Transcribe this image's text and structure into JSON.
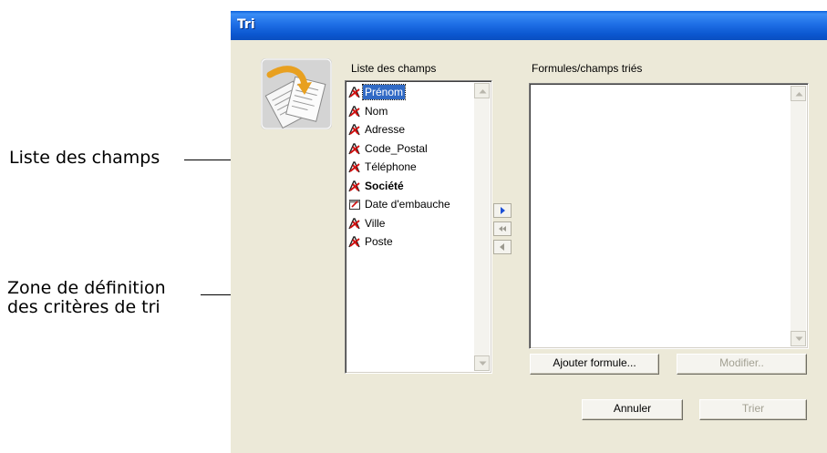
{
  "callouts": {
    "field_list": "Liste des champs",
    "criteria_line1": "Zone de définition",
    "criteria_line2": "des critères de tri"
  },
  "window": {
    "title": "Tri",
    "icon": "sort-documents-icon"
  },
  "fields_panel": {
    "label": "Liste des champs",
    "items": [
      {
        "label": "Prénom",
        "icon": "text-field-icon",
        "selected": true
      },
      {
        "label": "Nom",
        "icon": "text-field-icon"
      },
      {
        "label": "Adresse",
        "icon": "text-field-icon"
      },
      {
        "label": "Code_Postal",
        "icon": "text-field-icon"
      },
      {
        "label": "Téléphone",
        "icon": "text-field-icon"
      },
      {
        "label": "Société",
        "icon": "text-field-icon",
        "bold": true
      },
      {
        "label": "Date d'embauche",
        "icon": "date-field-icon"
      },
      {
        "label": "Ville",
        "icon": "text-field-icon"
      },
      {
        "label": "Poste",
        "icon": "text-field-icon"
      }
    ]
  },
  "sorted_panel": {
    "label": "Formules/champs triés",
    "items": []
  },
  "move_buttons": [
    {
      "icon": "arrow-right-icon",
      "enabled": true
    },
    {
      "icon": "double-arrow-left-icon",
      "enabled": false
    },
    {
      "icon": "arrow-left-icon",
      "enabled": false
    }
  ],
  "buttons": {
    "add_formula": "Ajouter formule...",
    "modify": "Modifier..",
    "cancel": "Annuler",
    "sort": "Trier"
  },
  "colors": {
    "title_bar": "#0b57d0",
    "dialog_bg": "#ece9d8",
    "selection": "#316ac5",
    "field_icon": "#d01010"
  }
}
